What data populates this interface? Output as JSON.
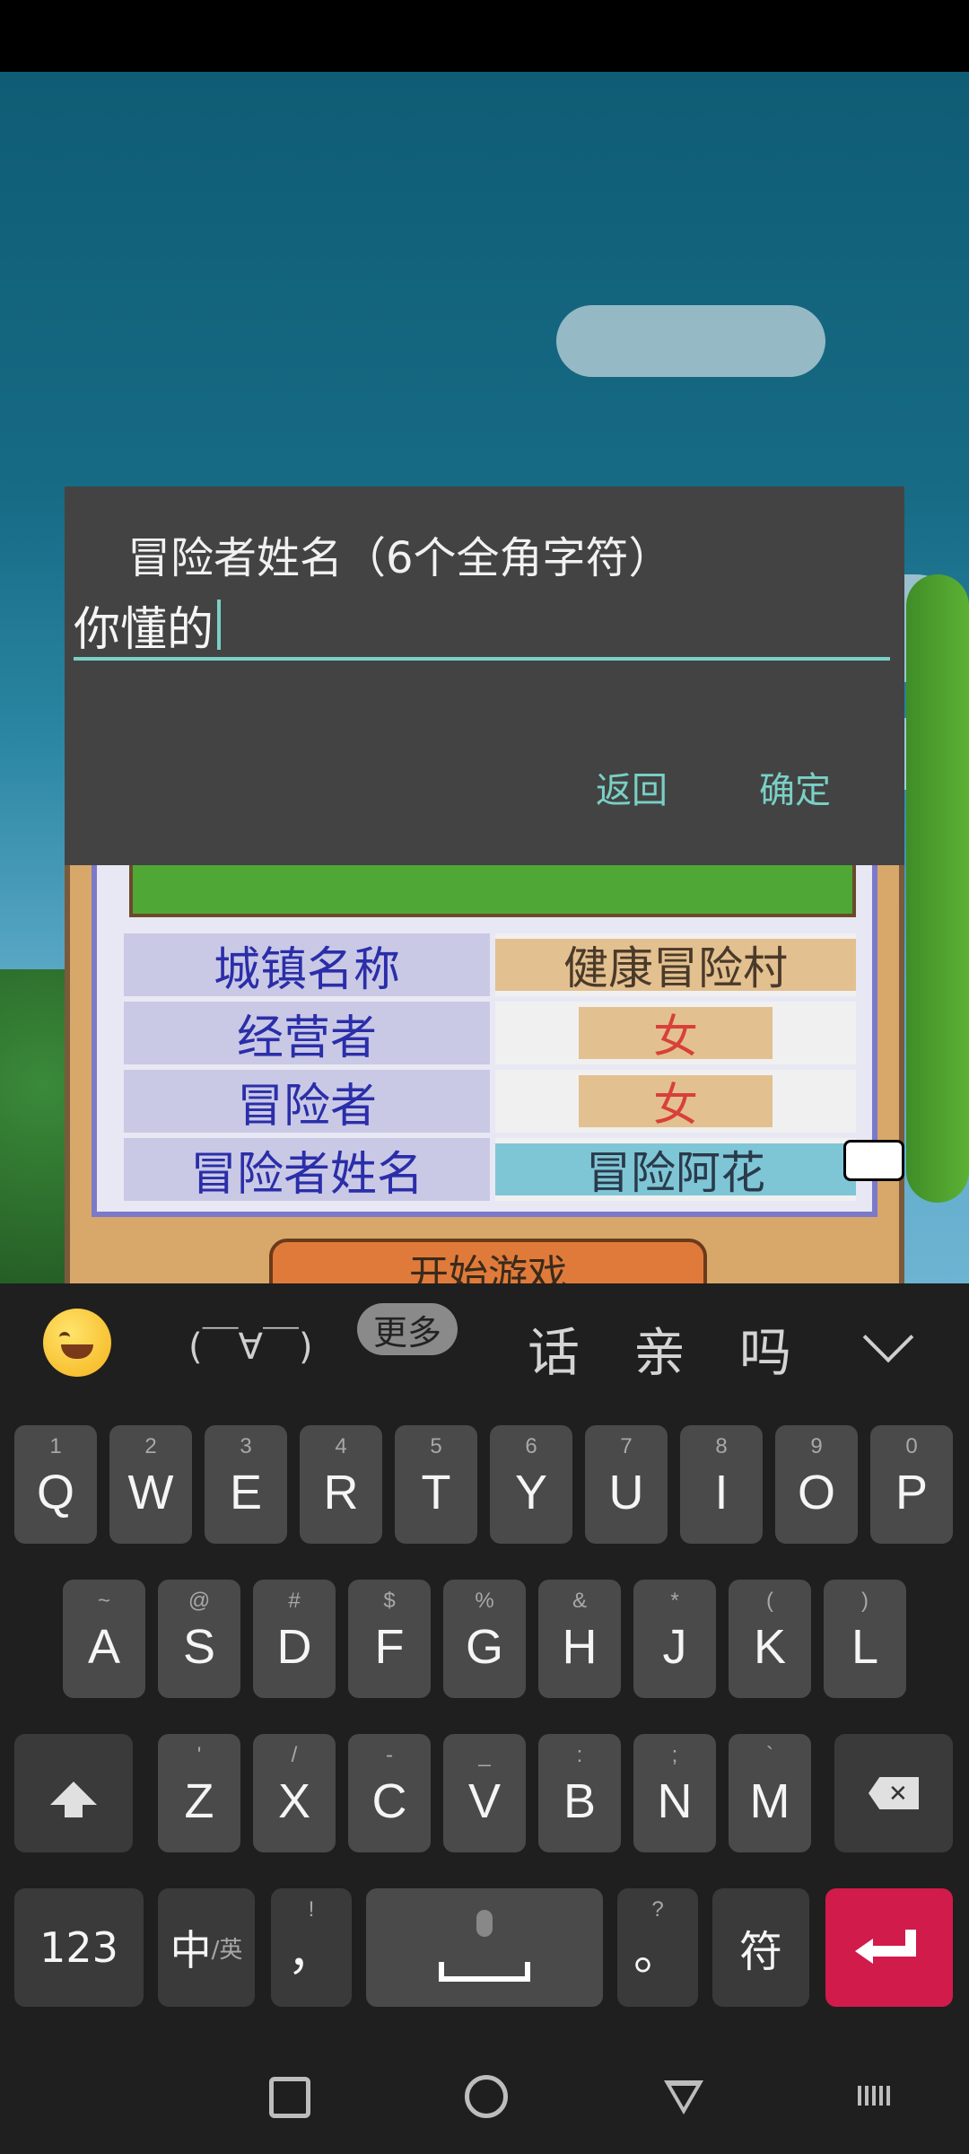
{
  "dialog": {
    "title": "冒险者姓名（6个全角字符）",
    "input_value": "你懂的",
    "cancel_label": "返回",
    "confirm_label": "确定"
  },
  "game_info": {
    "rows": [
      {
        "label": "城镇名称",
        "value": "健康冒险村"
      },
      {
        "label": "经营者",
        "value": "女"
      },
      {
        "label": "冒险者",
        "value": "女"
      },
      {
        "label": "冒险者姓名",
        "value": "冒险阿花"
      }
    ],
    "start_label": "开始游戏"
  },
  "keyboard": {
    "kaomoji": "(￣∀￣)",
    "more_label": "更多",
    "candidates": [
      "话",
      "亲",
      "吗"
    ],
    "row1": [
      {
        "main": "Q",
        "hint": "1"
      },
      {
        "main": "W",
        "hint": "2"
      },
      {
        "main": "E",
        "hint": "3"
      },
      {
        "main": "R",
        "hint": "4"
      },
      {
        "main": "T",
        "hint": "5"
      },
      {
        "main": "Y",
        "hint": "6"
      },
      {
        "main": "U",
        "hint": "7"
      },
      {
        "main": "I",
        "hint": "8"
      },
      {
        "main": "O",
        "hint": "9"
      },
      {
        "main": "P",
        "hint": "0"
      }
    ],
    "row2": [
      {
        "main": "A",
        "hint": "~"
      },
      {
        "main": "S",
        "hint": "@"
      },
      {
        "main": "D",
        "hint": "#"
      },
      {
        "main": "F",
        "hint": "$"
      },
      {
        "main": "G",
        "hint": "%"
      },
      {
        "main": "H",
        "hint": "&"
      },
      {
        "main": "J",
        "hint": "*"
      },
      {
        "main": "K",
        "hint": "("
      },
      {
        "main": "L",
        "hint": ")"
      }
    ],
    "row3": [
      {
        "main": "Z",
        "hint": "'"
      },
      {
        "main": "X",
        "hint": "/"
      },
      {
        "main": "C",
        "hint": "-"
      },
      {
        "main": "V",
        "hint": "_"
      },
      {
        "main": "B",
        "hint": ":"
      },
      {
        "main": "N",
        "hint": ";"
      },
      {
        "main": "M",
        "hint": "`"
      }
    ],
    "num_label": "123",
    "lang_main": "中",
    "lang_sub": "/英",
    "comma_main": "，",
    "comma_hint": "!",
    "period_main": "。",
    "period_hint": "?",
    "symbol_label": "符"
  },
  "colors": {
    "accent": "#79d0c5",
    "enter": "#d11b4a",
    "dialog_bg": "#434343"
  }
}
